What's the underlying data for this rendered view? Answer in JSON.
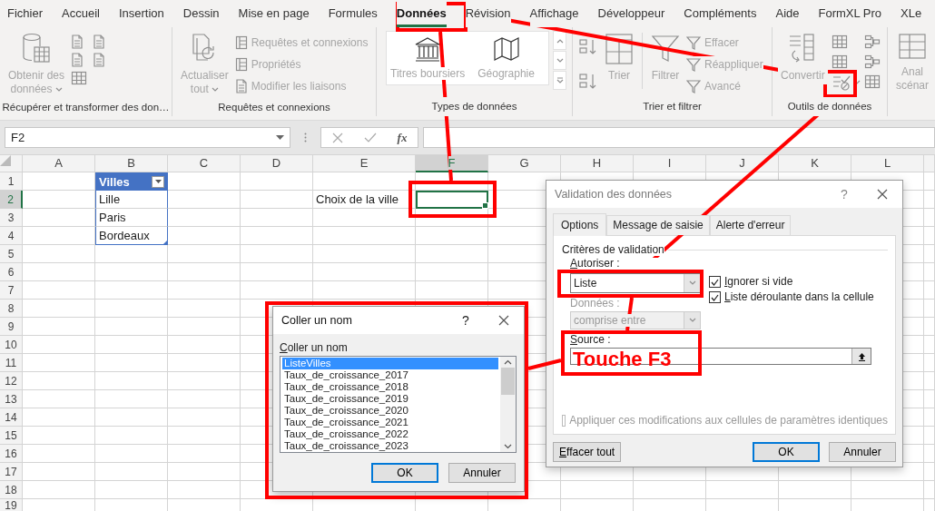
{
  "ribbon": {
    "tabs": [
      {
        "label": "Fichier",
        "selected": false
      },
      {
        "label": "Accueil",
        "selected": false
      },
      {
        "label": "Insertion",
        "selected": false
      },
      {
        "label": "Dessin",
        "selected": false
      },
      {
        "label": "Mise en page",
        "selected": false
      },
      {
        "label": "Formules",
        "selected": false
      },
      {
        "label": "Données",
        "selected": true
      },
      {
        "label": "Révision",
        "selected": false
      },
      {
        "label": "Affichage",
        "selected": false
      },
      {
        "label": "Développeur",
        "selected": false
      },
      {
        "label": "Compléments",
        "selected": false
      },
      {
        "label": "Aide",
        "selected": false
      },
      {
        "label": "FormXL Pro",
        "selected": false
      },
      {
        "label": "XLe",
        "selected": false
      }
    ],
    "groups": [
      {
        "kind": "import",
        "label": "Récupérer et transformer des don…",
        "controls": [
          {
            "kind": "large",
            "lines": [
              "Obtenir des",
              "données"
            ],
            "menu": true,
            "disabled": true
          }
        ]
      },
      {
        "kind": "queries",
        "label": "Requêtes et connexions",
        "controls": [
          {
            "kind": "large",
            "lines": [
              "Actualiser",
              "tout"
            ],
            "menu": true,
            "disabled": true
          },
          {
            "kind": "small",
            "label": "Requêtes et connexions",
            "disabled": true
          },
          {
            "kind": "small",
            "label": "Propriétés",
            "disabled": true
          },
          {
            "kind": "small",
            "label": "Modifier les liaisons",
            "disabled": true
          }
        ]
      },
      {
        "kind": "types",
        "label": "Types de données",
        "controls": [
          {
            "kind": "gallery",
            "label": "Titres boursiers",
            "disabled": true
          },
          {
            "kind": "gallery",
            "label": "Géographie",
            "disabled": true
          }
        ]
      },
      {
        "kind": "sort",
        "label": "Trier et filtrer",
        "controls": [
          {
            "kind": "large",
            "lines": [
              "Trier"
            ],
            "menu": false,
            "disabled": true
          },
          {
            "kind": "large",
            "lines": [
              "Filtrer"
            ],
            "menu": false,
            "disabled": true
          },
          {
            "kind": "small",
            "label": "Effacer",
            "disabled": true
          },
          {
            "kind": "small",
            "label": "Réappliquer",
            "disabled": true
          },
          {
            "kind": "small",
            "label": "Avancé",
            "disabled": true
          }
        ]
      },
      {
        "kind": "tools",
        "label": "Outils de données",
        "controls": [
          {
            "kind": "large",
            "lines": [
              "Convertir"
            ],
            "menu": false,
            "disabled": true
          }
        ]
      },
      {
        "kind": "analysis",
        "controls": [
          {
            "kind": "large",
            "lines": [
              "Anal",
              "scénar"
            ],
            "menu": false,
            "disabled": true
          }
        ]
      }
    ]
  },
  "formula_bar": {
    "name_box": "F2",
    "function_label": "fx"
  },
  "sheet": {
    "columns": [
      {
        "label": "A",
        "selected": false
      },
      {
        "label": "B",
        "selected": false
      },
      {
        "label": "C",
        "selected": false
      },
      {
        "label": "D",
        "selected": false
      },
      {
        "label": "E",
        "selected": false
      },
      {
        "label": "F",
        "selected": true
      },
      {
        "label": "G",
        "selected": false
      },
      {
        "label": "H",
        "selected": false
      },
      {
        "label": "I",
        "selected": false
      },
      {
        "label": "J",
        "selected": false
      },
      {
        "label": "K",
        "selected": false
      },
      {
        "label": "L",
        "selected": false
      }
    ],
    "rows": [
      {
        "label": "1",
        "selected": false
      },
      {
        "label": "2",
        "selected": true
      },
      {
        "label": "3",
        "selected": false
      },
      {
        "label": "4",
        "selected": false
      },
      {
        "label": "5",
        "selected": false
      },
      {
        "label": "6",
        "selected": false
      },
      {
        "label": "7",
        "selected": false
      },
      {
        "label": "8",
        "selected": false
      },
      {
        "label": "9",
        "selected": false
      },
      {
        "label": "10",
        "selected": false
      },
      {
        "label": "11",
        "selected": false
      },
      {
        "label": "12",
        "selected": false
      },
      {
        "label": "13",
        "selected": false
      },
      {
        "label": "14",
        "selected": false
      },
      {
        "label": "15",
        "selected": false
      },
      {
        "label": "16",
        "selected": false
      },
      {
        "label": "17",
        "selected": false
      },
      {
        "label": "18",
        "selected": false
      },
      {
        "label": "19",
        "selected": false
      }
    ],
    "table": {
      "header": "Villes",
      "values": [
        "Lille",
        "Paris",
        "Bordeaux"
      ]
    },
    "label_cell": "Choix de la ville"
  },
  "validation_dialog": {
    "title": "Validation des données",
    "help": "?",
    "tabs": [
      {
        "label": "Options",
        "selected": true
      },
      {
        "label": "Message de saisie",
        "selected": false
      },
      {
        "label": "Alerte d'erreur",
        "selected": false
      }
    ],
    "section": "Critères de validation",
    "allow": {
      "label": "Autoriser :",
      "value": "Liste"
    },
    "data": {
      "label": "Données :",
      "value": "comprise entre",
      "disabled": true
    },
    "checkboxes": [
      {
        "label": "Ignorer si vide",
        "checked": true
      },
      {
        "label": "Liste déroulante dans la cellule",
        "checked": true
      }
    ],
    "source": {
      "label": "Source :"
    },
    "apply_all": {
      "label": "Appliquer ces modifications aux cellules de paramètres identiques",
      "checked": false,
      "disabled": true
    },
    "buttons": [
      {
        "label": "Effacer tout",
        "default": false
      },
      {
        "label": "OK",
        "default": true
      },
      {
        "label": "Annuler",
        "default": false
      }
    ]
  },
  "paste_dialog": {
    "title": "Coller un nom",
    "help": "?",
    "list_label": "Coller un nom",
    "items": [
      {
        "label": "ListeVilles",
        "selected": true
      },
      {
        "label": "Taux_de_croissance_2017",
        "selected": false
      },
      {
        "label": "Taux_de_croissance_2018",
        "selected": false
      },
      {
        "label": "Taux_de_croissance_2019",
        "selected": false
      },
      {
        "label": "Taux_de_croissance_2020",
        "selected": false
      },
      {
        "label": "Taux_de_croissance_2021",
        "selected": false
      },
      {
        "label": "Taux_de_croissance_2022",
        "selected": false
      },
      {
        "label": "Taux_de_croissance_2023",
        "selected": false
      }
    ],
    "buttons": [
      {
        "label": "OK",
        "default": true
      },
      {
        "label": "Annuler",
        "default": false
      }
    ]
  },
  "annotations": {
    "callout": "Touche F3"
  }
}
